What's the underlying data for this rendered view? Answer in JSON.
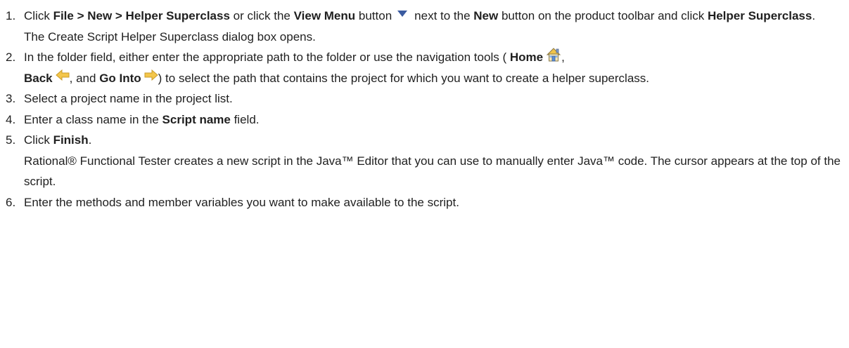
{
  "steps": [
    {
      "num": "1.",
      "p1_t1": "Click ",
      "p1_b1": "File > New > Helper Superclass",
      "p1_t2": " or click the ",
      "p1_b2": "View Menu",
      "p1_t3": " button",
      "p1_t4": "next to the ",
      "p1_b3": "New",
      "p1_t5": " button on the product toolbar and click ",
      "p1_b4": "Helper Superclass",
      "p1_t6": ".",
      "result": "The Create Script Helper Superclass dialog box opens."
    },
    {
      "num": "2.",
      "t1": "In the folder field, either enter the appropriate path to the folder or use the navigation tools ( ",
      "b1": "Home",
      "t2": ",",
      "b2": "Back",
      "t3": ", and ",
      "b3": "Go Into",
      "t4": ") to select the path that contains the project for which you want to create a helper superclass."
    },
    {
      "num": "3.",
      "text": "Select a project name in the project list."
    },
    {
      "num": "4.",
      "t1": "Enter a class name in the ",
      "b1": "Script name",
      "t2": " field."
    },
    {
      "num": "5.",
      "t1": "Click ",
      "b1": "Finish",
      "t2": ".",
      "result": "Rational® Functional Tester creates a new script in the Java™ Editor that you can use to manually enter Java™ code. The cursor appears at the top of the script."
    },
    {
      "num": "6.",
      "text": "Enter the methods and member variables you want to make available to the script."
    }
  ],
  "icons": {
    "view_menu": "view-menu-triangle-icon",
    "home": "home-icon",
    "back": "back-arrow-icon",
    "go_into": "go-into-arrow-icon"
  },
  "colors": {
    "text": "#1f1f1f",
    "view_menu_icon": "#3b5ba0",
    "arrow_icon": "#f4c64a"
  }
}
